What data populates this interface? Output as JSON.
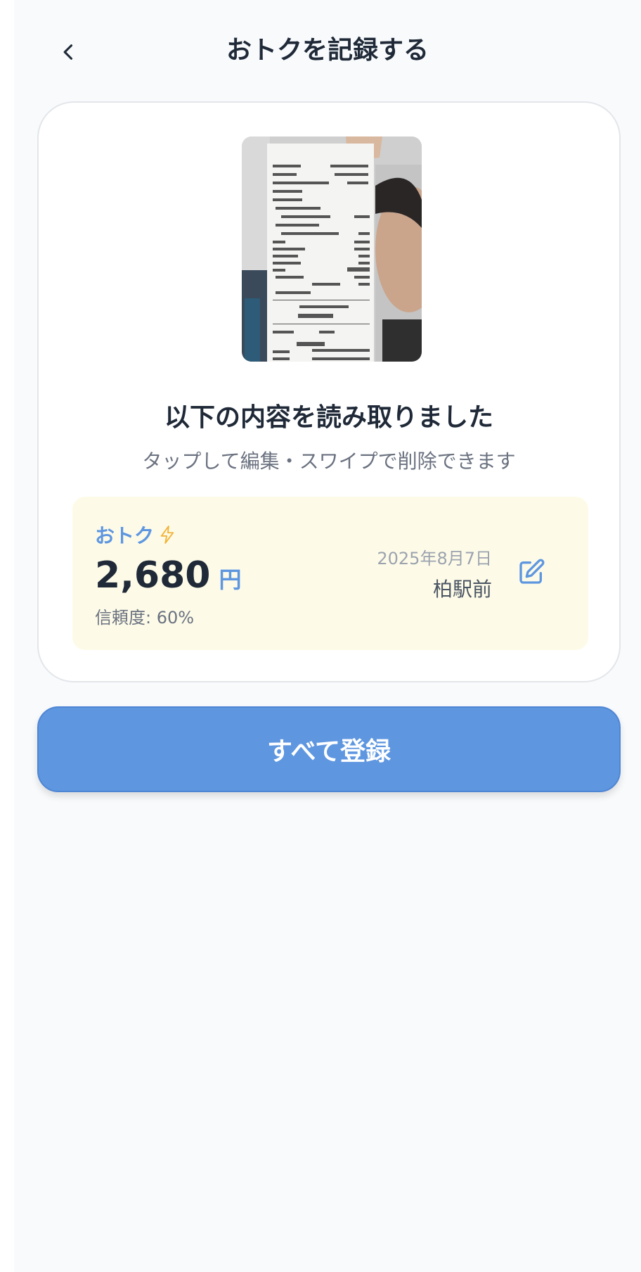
{
  "header": {
    "title": "おトクを記録する",
    "back_icon": "chevron-left-icon"
  },
  "receipt_image": {
    "alt": "receipt-photo"
  },
  "result": {
    "title": "以下の内容を読み取りました",
    "subtitle": "タップして編集・スワイプで削除できます"
  },
  "deal": {
    "type_label": "おトク",
    "type_icon": "lightning-icon",
    "amount": "2,680",
    "unit": "円",
    "confidence": "信頼度: 60%",
    "date": "2025年8月7日",
    "store": "柏駅前",
    "edit_icon": "edit-icon"
  },
  "register_button": "すべて登録",
  "colors": {
    "accent": "#5e96e0",
    "deal_bg": "#fdfbe8",
    "lightning": "#f2b336"
  }
}
